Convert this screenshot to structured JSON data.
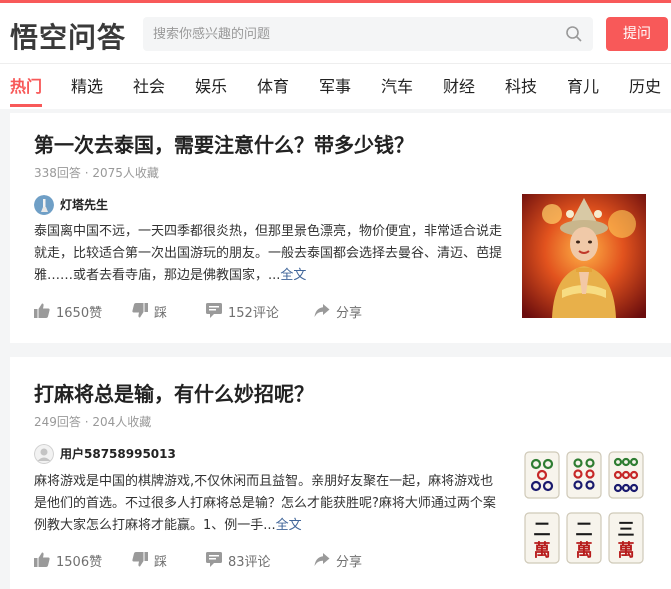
{
  "header": {
    "logo_text": "悟空问答",
    "search_placeholder": "搜索你感兴趣的问题",
    "ask_label": "提问",
    "brand_color": "#f85959"
  },
  "nav": {
    "items": [
      "热门",
      "精选",
      "社会",
      "娱乐",
      "体育",
      "军事",
      "汽车",
      "财经",
      "科技",
      "育儿",
      "历史"
    ],
    "active": "热门"
  },
  "questions": [
    {
      "title": "第一次去泰国，需要注意什么？带多少钱？",
      "stats": "338回答 · 2075人收藏",
      "author": "灯塔先生",
      "excerpt": "泰国离中国不远，一天四季都很炎热，但那里景色漂亮，物价便宜，非常适合说走就走，比较适合第一次出国游玩的朋友。一般去泰国都会选择去曼谷、清迈、芭提雅……或者去看寺庙，那边是佛教国家，...",
      "more": "全文",
      "likes": "1650赞",
      "dislike": "踩",
      "comments": "152评论",
      "share": "分享",
      "image": "thai-dancer-photo"
    },
    {
      "title": "打麻将总是输，有什么妙招呢？",
      "stats": "249回答 · 204人收藏",
      "author": "用户58758995013",
      "excerpt": "麻将游戏是中国的棋牌游戏,不仅休闲而且益智。亲朋好友聚在一起，麻将游戏也是他们的首选。不过很多人打麻将总是输？怎么才能获胜呢?麻将大师通过两个案例教大家怎么打麻将才能赢。1、例一手...",
      "more": "全文",
      "likes": "1506赞",
      "dislike": "踩",
      "comments": "83评论",
      "share": "分享",
      "image": "mahjong-tiles-photo",
      "tile_chars": [
        "二",
        "萬",
        "二",
        "萬",
        "三",
        "萬"
      ]
    }
  ]
}
